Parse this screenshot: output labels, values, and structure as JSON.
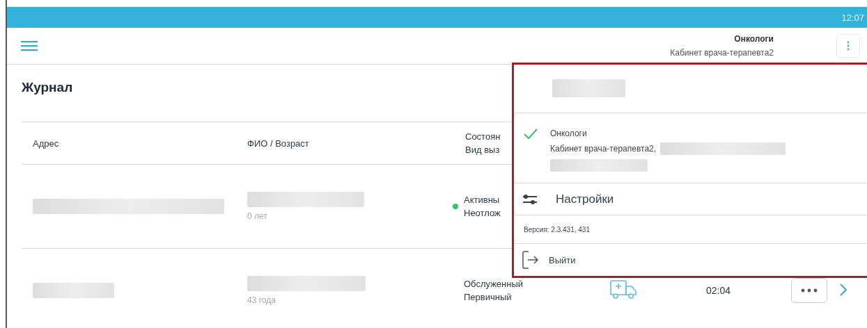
{
  "status_bar": {
    "time": "12:07"
  },
  "header": {
    "org": "Онкологи",
    "cabinet": "Кабинет врача-терапевта2"
  },
  "page_title": "Журнал",
  "table": {
    "columns": [
      {
        "lines": [
          "Адрес"
        ]
      },
      {
        "lines": [
          "ФИО / Возраст"
        ]
      },
      {
        "lines": [
          "Состоян",
          "Вид выз"
        ]
      }
    ],
    "rows": [
      {
        "age": "0 лет",
        "status": "Активны",
        "call_type": "Неотлож",
        "color": "#34c76a",
        "ambulance_icon": false
      },
      {
        "age": "43 года",
        "status": "Обслуженный",
        "call_type": "Первичный",
        "ambulance_icon": true,
        "time": "02:04"
      }
    ]
  },
  "menu": {
    "accounts": [
      {
        "org": "Онкологи",
        "cabinet": "Кабинет врача-терапевта2,",
        "selected": true
      }
    ],
    "settings": "Настройки",
    "version": "Версия: 2.3.431, 431",
    "logout": "Выйти"
  }
}
